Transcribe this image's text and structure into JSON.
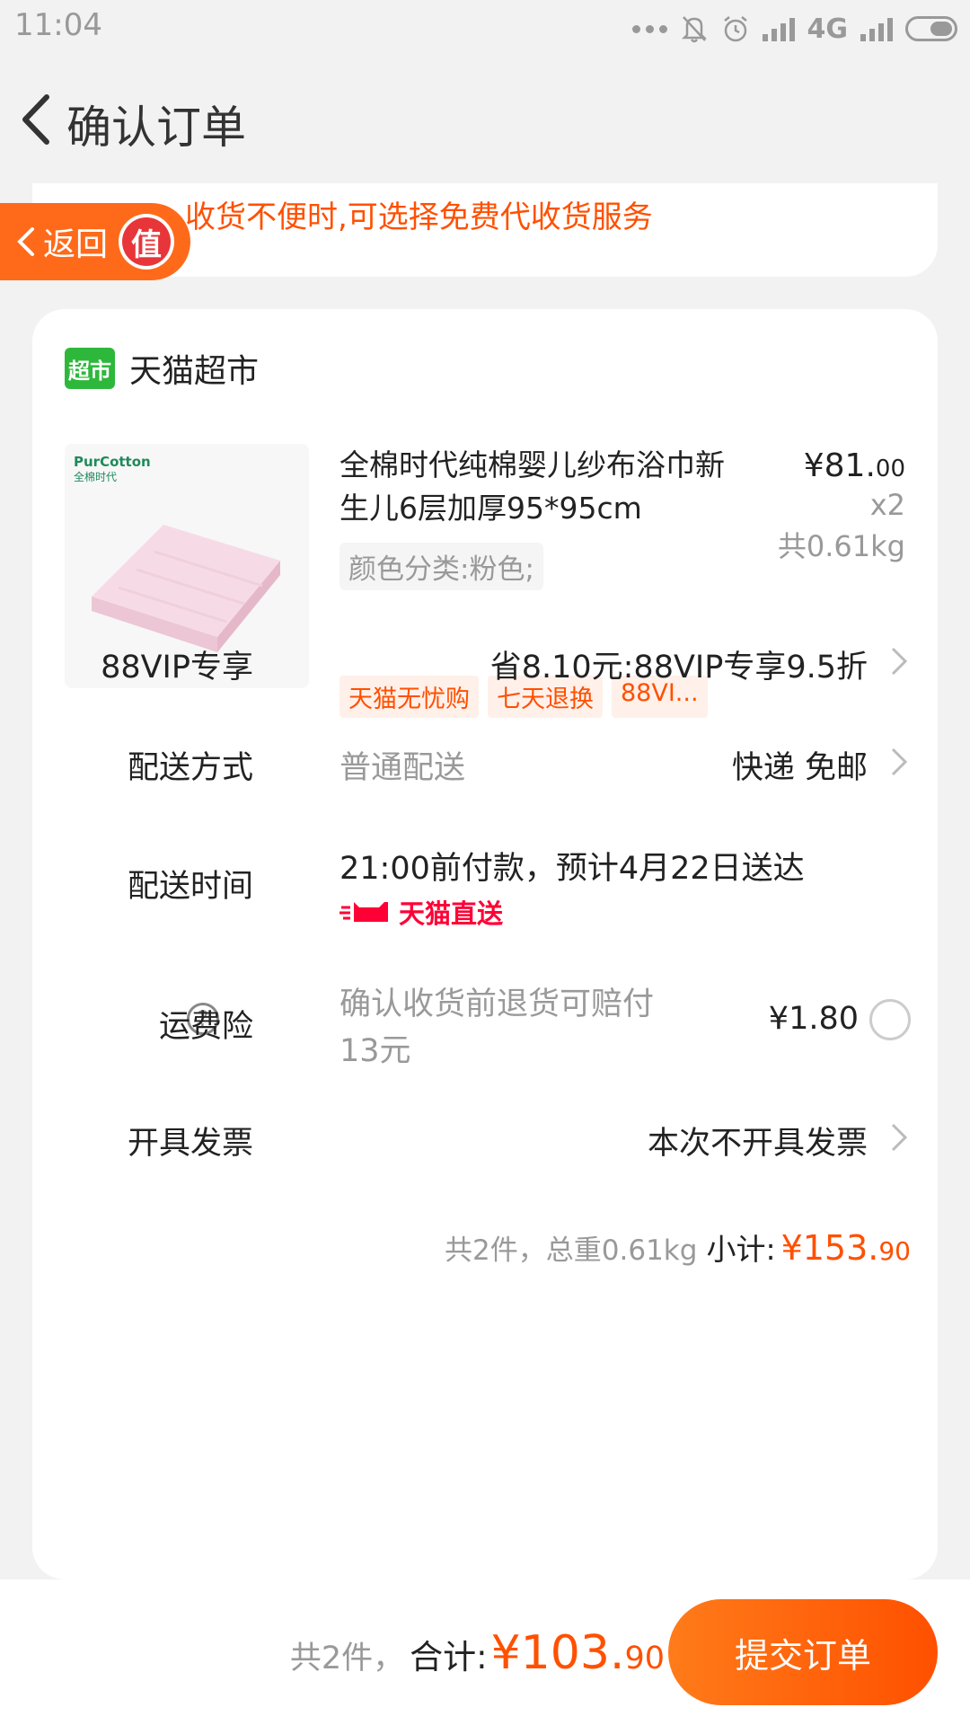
{
  "status_bar": {
    "time": "11:04",
    "network": "4G"
  },
  "header": {
    "title": "确认订单"
  },
  "notice": {
    "text": "收货不便时,可选择免费代收货服务"
  },
  "return_pill": {
    "label": "返回",
    "badge": "值"
  },
  "shop": {
    "icon_text": "超市",
    "name": "天猫超市"
  },
  "product": {
    "brand_logo": "PurCotton",
    "brand_logo_cn": "全棉时代",
    "title": "全棉时代纯棉婴儿纱布浴巾新生儿6层加厚95*95cm",
    "sku": "颜色分类:粉色;",
    "price_main": "¥81.",
    "price_decimal": "00",
    "qty": "x2",
    "weight": "共0.61kg",
    "tags": [
      "天猫无忧购",
      "七天退换",
      "88VI..."
    ]
  },
  "vip": {
    "label": "88VIP专享",
    "value": "省8.10元:88VIP专享9.5折"
  },
  "shipping": {
    "label": "配送方式",
    "sub": "普通配送",
    "value": "快递 免邮"
  },
  "delivery_time": {
    "label": "配送时间",
    "text": "21:00前付款，预计4月22日送达",
    "badge": "天猫直送"
  },
  "insurance": {
    "label": "运费险",
    "desc": "确认收货前退货可赔付13元",
    "price": "¥1.80",
    "help": "?"
  },
  "invoice": {
    "label": "开具发票",
    "value": "本次不开具发票"
  },
  "subtotal": {
    "count": "共2件，总重0.61kg",
    "label": "小计:",
    "amount_main": "¥153.",
    "amount_decimal": "90"
  },
  "bottom": {
    "count": "共2件，",
    "label": "合计:",
    "amount_main": "¥103.",
    "amount_decimal": "90",
    "submit": "提交订单"
  },
  "colors": {
    "accent": "#ff5000",
    "tmall_red": "#ff0036",
    "shop_green": "#2eb83b"
  }
}
